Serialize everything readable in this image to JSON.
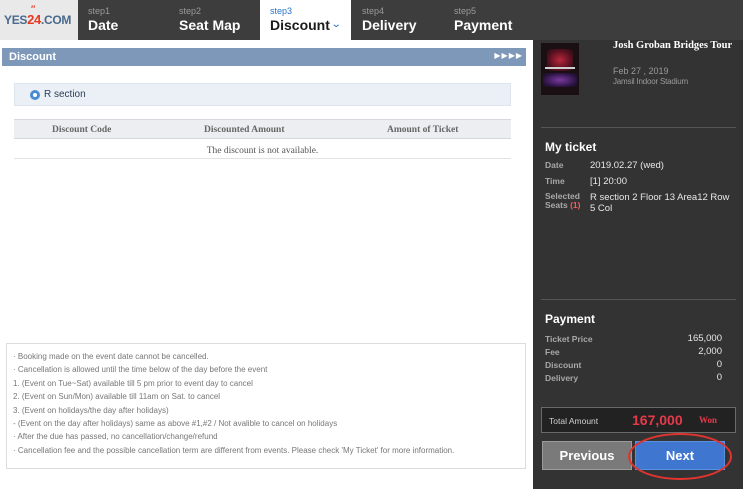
{
  "logo": {
    "prefix": "YES",
    "number": "24",
    "suffix": ".COM"
  },
  "steps": [
    {
      "num": "step1",
      "label": "Date"
    },
    {
      "num": "step2",
      "label": "Seat Map"
    },
    {
      "num": "step3",
      "label": "Discount",
      "active": true
    },
    {
      "num": "step4",
      "label": "Delivery"
    },
    {
      "num": "step5",
      "label": "Payment"
    }
  ],
  "discount_panel": {
    "title": "Discount",
    "header_arrows": "▶▶▶▶",
    "section": "R section",
    "table": {
      "columns": [
        "Discount Code",
        "Discounted Amount",
        "Amount of Ticket"
      ],
      "empty_message": "The discount is not available."
    }
  },
  "notice": [
    "· Booking made on the event date cannot be cancelled.",
    "· Cancellation is allowed until the time below of the day before the event",
    "  1. (Event on Tue~Sat) available till 5 pm prior to event day to cancel",
    "  2. (Event on Sun/Mon) available till 11am on Sat. to cancel",
    "  3. (Event on holidays/the day after holidays)",
    "  - (Event on the day after holidays) same as above #1,#2 / Not avalible to cancel on holidays",
    "· After the due has passed, no cancellation/change/refund",
    "· Cancellation fee and the possible cancellation term are different from events. Please check 'My Ticket' for more information."
  ],
  "show": {
    "title": "Josh Groban Bridges Tour",
    "date": "Feb 27 , 2019",
    "venue": "Jamsil Indoor Stadium"
  },
  "my_ticket": {
    "heading": "My ticket",
    "date_label": "Date",
    "date_value": "2019.02.27 (wed)",
    "time_label": "Time",
    "time_value": "[1] 20:00",
    "seats_label": "Selected Seats",
    "seats_count": "(1)",
    "seats_value": "R section 2 Floor 13 Area12 Row 5 Col"
  },
  "payment": {
    "heading": "Payment",
    "ticket_price_label": "Ticket Price",
    "ticket_price_value": "165,000",
    "fee_label": "Fee",
    "fee_value": "2,000",
    "discount_label": "Discount",
    "discount_value": "0",
    "delivery_label": "Delivery",
    "delivery_value": "0"
  },
  "total": {
    "label": "Total Amount",
    "amount": "167,000",
    "unit": "Won"
  },
  "buttons": {
    "previous": "Previous",
    "next": "Next"
  },
  "colors": {
    "topbar": "#3d3d3d",
    "active_step": "#2a74c9",
    "panel_header": "#7e98b9",
    "sidebar": "#333333",
    "total_amount": "#e63a4a",
    "next_button": "#3f76d0",
    "highlight_ring": "#e0342e"
  }
}
